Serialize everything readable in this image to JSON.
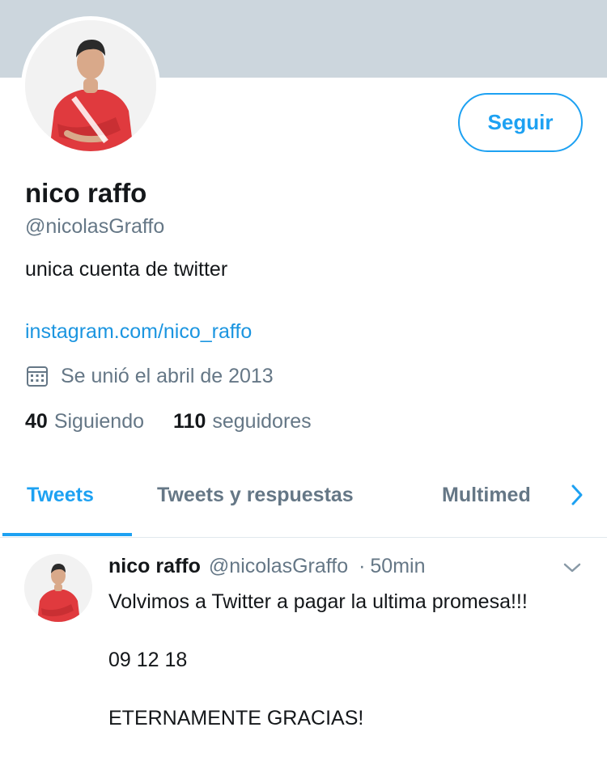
{
  "profile": {
    "name": "nico raffo",
    "handle": "@nicolasGraffo",
    "bio": "unica cuenta de twitter",
    "link": "instagram.com/nico_raffo",
    "joined": "Se unió el abril de 2013",
    "follow_label": "Seguir",
    "following_count": "40",
    "following_label": "Siguiendo",
    "followers_count": "110",
    "followers_label": "seguidores"
  },
  "tabs": [
    {
      "label": "Tweets",
      "active": true
    },
    {
      "label": "Tweets y respuestas",
      "active": false
    },
    {
      "label": "Multimed",
      "active": false
    }
  ],
  "tweet": {
    "name": "nico raffo",
    "handle": "@nicolasGraffo",
    "separator": "·",
    "time": "50min",
    "text": "Volvimos a Twitter a pagar la ultima promesa!!!\n\n09 12 18\n\nETERNAMENTE GRACIAS!"
  },
  "icons": {
    "calendar": "calendar-icon",
    "chevron_right": "chevron-right-icon",
    "chevron_down": "chevron-down-icon"
  },
  "colors": {
    "accent": "#1da1f2",
    "link": "#1b95e0",
    "muted": "#657786",
    "banner": "#ccd6dd",
    "jersey": "#e03a3e"
  }
}
